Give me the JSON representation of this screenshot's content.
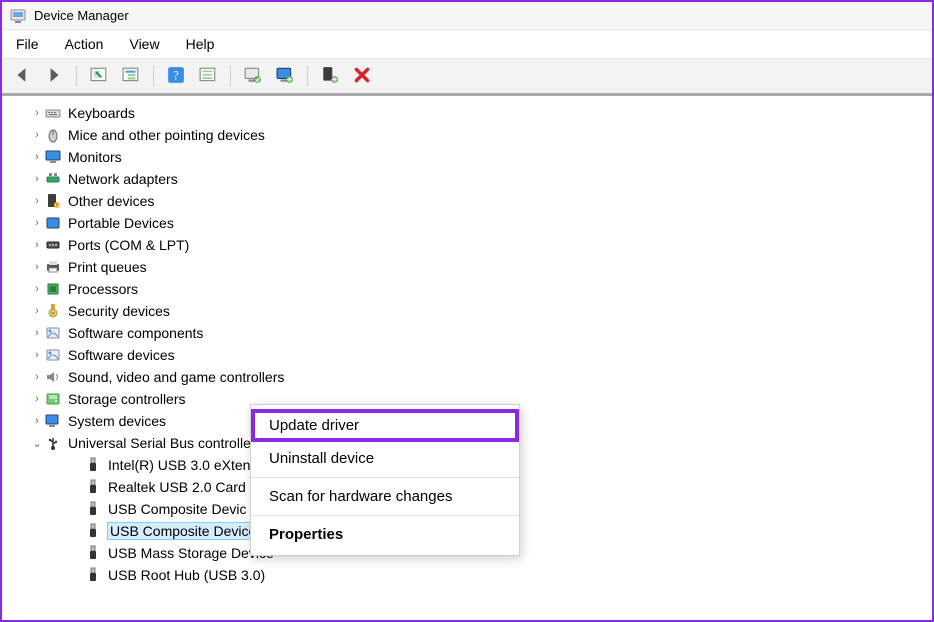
{
  "window": {
    "title": "Device Manager"
  },
  "menubar": {
    "items": [
      "File",
      "Action",
      "View",
      "Help"
    ]
  },
  "toolbar": {
    "buttons": [
      {
        "name": "back-button",
        "icon": "arrow-left-icon"
      },
      {
        "name": "forward-button",
        "icon": "arrow-right-icon"
      },
      {
        "sep": true
      },
      {
        "name": "show-hidden-button",
        "icon": "panel-search-icon"
      },
      {
        "name": "devices-by-type-button",
        "icon": "panel-tree-icon"
      },
      {
        "sep": true
      },
      {
        "name": "help-button",
        "icon": "help-icon"
      },
      {
        "name": "list-icon-button",
        "icon": "list-icon"
      },
      {
        "sep": true
      },
      {
        "name": "update-driver-button",
        "icon": "update-pc-icon"
      },
      {
        "name": "scan-hardware-button",
        "icon": "monitor-scan-icon"
      },
      {
        "sep": true
      },
      {
        "name": "uninstall-button",
        "icon": "pc-plus-icon"
      },
      {
        "name": "remove-button",
        "icon": "red-x-icon"
      }
    ]
  },
  "tree": {
    "nodes": [
      {
        "label": "Keyboards",
        "icon": "keyboard-icon",
        "expandable": true
      },
      {
        "label": "Mice and other pointing devices",
        "icon": "mouse-icon",
        "expandable": true
      },
      {
        "label": "Monitors",
        "icon": "monitor-icon",
        "expandable": true
      },
      {
        "label": "Network adapters",
        "icon": "network-icon",
        "expandable": true
      },
      {
        "label": "Other devices",
        "icon": "other-device-icon",
        "expandable": true
      },
      {
        "label": "Portable Devices",
        "icon": "portable-icon",
        "expandable": true
      },
      {
        "label": "Ports (COM & LPT)",
        "icon": "port-icon",
        "expandable": true
      },
      {
        "label": "Print queues",
        "icon": "printer-icon",
        "expandable": true
      },
      {
        "label": "Processors",
        "icon": "cpu-icon",
        "expandable": true
      },
      {
        "label": "Security devices",
        "icon": "security-icon",
        "expandable": true
      },
      {
        "label": "Software components",
        "icon": "software-icon",
        "expandable": true
      },
      {
        "label": "Software devices",
        "icon": "software-icon",
        "expandable": true
      },
      {
        "label": "Sound, video and game controllers",
        "icon": "sound-icon",
        "expandable": true
      },
      {
        "label": "Storage controllers",
        "icon": "storage-icon",
        "expandable": true
      },
      {
        "label": "System devices",
        "icon": "system-icon",
        "expandable": true
      },
      {
        "label": "Universal Serial Bus controllers",
        "icon": "usb-icon",
        "expandable": true,
        "expanded": true,
        "children": [
          {
            "label": "Intel(R) USB 3.0 eXten",
            "icon": "usb-plug-icon"
          },
          {
            "label": "Realtek USB 2.0 Card",
            "icon": "usb-plug-icon"
          },
          {
            "label": "USB Composite Devic",
            "icon": "usb-plug-icon"
          },
          {
            "label": "USB Composite Device",
            "icon": "usb-plug-icon",
            "selected": true
          },
          {
            "label": "USB Mass Storage Device",
            "icon": "usb-plug-icon"
          },
          {
            "label": "USB Root Hub (USB 3.0)",
            "icon": "usb-plug-icon"
          }
        ]
      }
    ]
  },
  "contextmenu": {
    "items": [
      {
        "label": "Update driver",
        "highlight": true
      },
      {
        "label": "Uninstall device"
      },
      {
        "sep": true
      },
      {
        "label": "Scan for hardware changes"
      },
      {
        "sep": true
      },
      {
        "label": "Properties",
        "bold": true
      }
    ]
  }
}
